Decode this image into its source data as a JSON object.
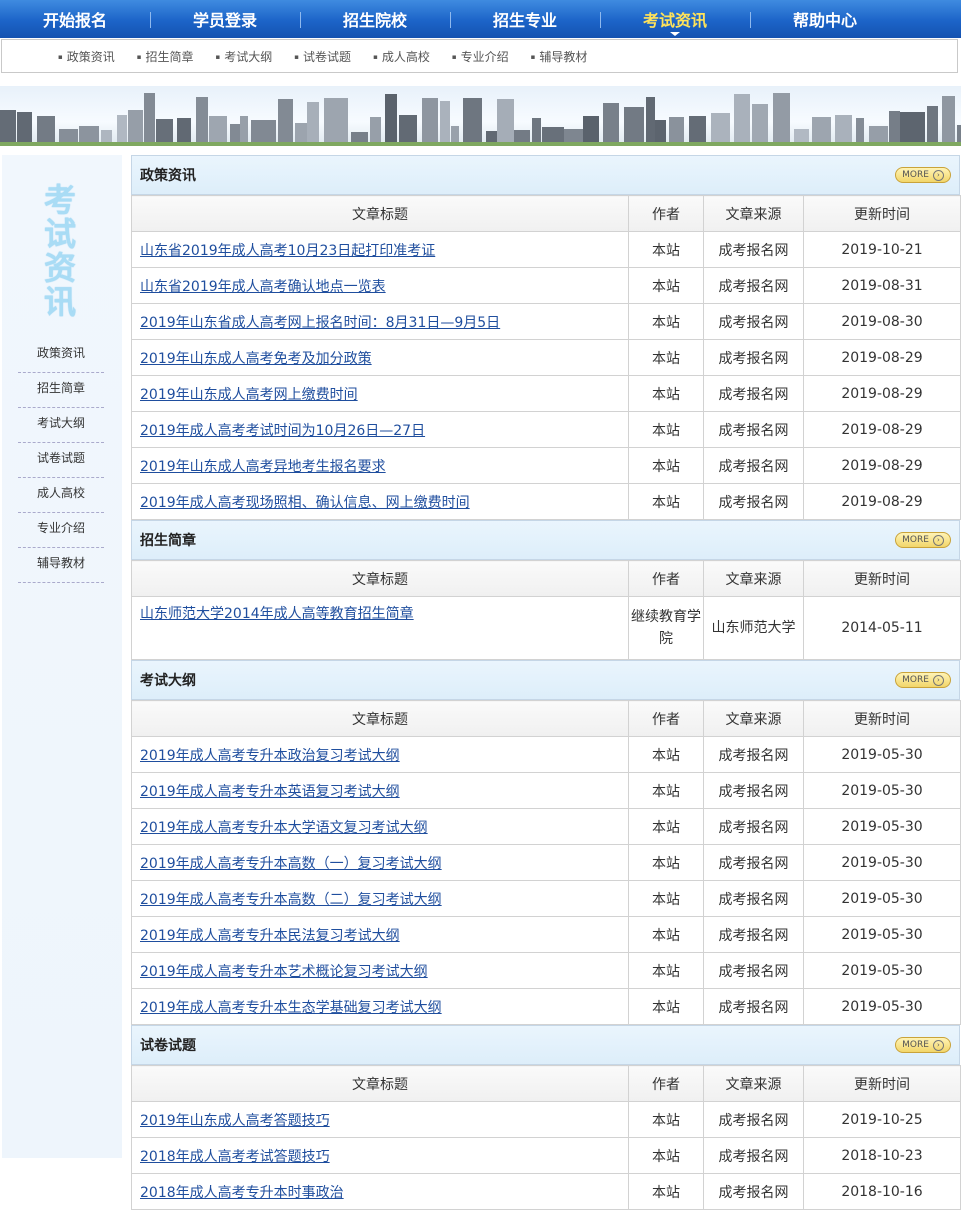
{
  "topnav": [
    {
      "label": "开始报名",
      "active": false
    },
    {
      "label": "学员登录",
      "active": false
    },
    {
      "label": "招生院校",
      "active": false
    },
    {
      "label": "招生专业",
      "active": false
    },
    {
      "label": "考试资讯",
      "active": true
    },
    {
      "label": "帮助中心",
      "active": false
    }
  ],
  "subnav": [
    "政策资讯",
    "招生简章",
    "考试大纲",
    "试卷试题",
    "成人高校",
    "专业介绍",
    "辅导教材"
  ],
  "sidebar": {
    "title": "考试资讯",
    "items": [
      "政策资讯",
      "招生简章",
      "考试大纲",
      "试卷试题",
      "成人高校",
      "专业介绍",
      "辅导教材"
    ]
  },
  "table_headers": {
    "title": "文章标题",
    "author": "作者",
    "source": "文章来源",
    "date": "更新时间"
  },
  "more_label": "MORE",
  "sections": [
    {
      "title": "政策资讯",
      "rows": [
        {
          "title": "山东省2019年成人高考10月23日起打印准考证",
          "author": "本站",
          "source": "成考报名网",
          "date": "2019-10-21"
        },
        {
          "title": "山东省2019年成人高考确认地点一览表",
          "author": "本站",
          "source": "成考报名网",
          "date": "2019-08-31"
        },
        {
          "title": "2019年山东省成人高考网上报名时间：8月31日—9月5日",
          "author": "本站",
          "source": "成考报名网",
          "date": "2019-08-30"
        },
        {
          "title": "2019年山东成人高考免考及加分政策",
          "author": "本站",
          "source": "成考报名网",
          "date": "2019-08-29"
        },
        {
          "title": "2019年山东成人高考网上缴费时间",
          "author": "本站",
          "source": "成考报名网",
          "date": "2019-08-29"
        },
        {
          "title": "2019年成人高考考试时间为10月26日—27日",
          "author": "本站",
          "source": "成考报名网",
          "date": "2019-08-29"
        },
        {
          "title": "2019年山东成人高考异地考生报名要求",
          "author": "本站",
          "source": "成考报名网",
          "date": "2019-08-29"
        },
        {
          "title": "2019年成人高考现场照相、确认信息、网上缴费时间",
          "author": "本站",
          "source": "成考报名网",
          "date": "2019-08-29"
        }
      ]
    },
    {
      "title": "招生简章",
      "rows": [
        {
          "title": "山东师范大学2014年成人高等教育招生简章",
          "author": "继续教育学院",
          "source": "山东师范大学",
          "date": "2014-05-11",
          "tall": true
        }
      ]
    },
    {
      "title": "考试大纲",
      "rows": [
        {
          "title": "2019年成人高考专升本政治复习考试大纲",
          "author": "本站",
          "source": "成考报名网",
          "date": "2019-05-30"
        },
        {
          "title": "2019年成人高考专升本英语复习考试大纲",
          "author": "本站",
          "source": "成考报名网",
          "date": "2019-05-30"
        },
        {
          "title": "2019年成人高考专升本大学语文复习考试大纲",
          "author": "本站",
          "source": "成考报名网",
          "date": "2019-05-30"
        },
        {
          "title": "2019年成人高考专升本高数（一）复习考试大纲",
          "author": "本站",
          "source": "成考报名网",
          "date": "2019-05-30"
        },
        {
          "title": "2019年成人高考专升本高数（二）复习考试大纲",
          "author": "本站",
          "source": "成考报名网",
          "date": "2019-05-30"
        },
        {
          "title": "2019年成人高考专升本民法复习考试大纲",
          "author": "本站",
          "source": "成考报名网",
          "date": "2019-05-30"
        },
        {
          "title": "2019年成人高考专升本艺术概论复习考试大纲",
          "author": "本站",
          "source": "成考报名网",
          "date": "2019-05-30"
        },
        {
          "title": "2019年成人高考专升本生态学基础复习考试大纲",
          "author": "本站",
          "source": "成考报名网",
          "date": "2019-05-30"
        }
      ]
    },
    {
      "title": "试卷试题",
      "rows": [
        {
          "title": "2019年山东成人高考答题技巧",
          "author": "本站",
          "source": "成考报名网",
          "date": "2019-10-25"
        },
        {
          "title": "2018年成人高考考试答题技巧",
          "author": "本站",
          "source": "成考报名网",
          "date": "2018-10-23"
        },
        {
          "title": "2018年成人高考专升本时事政治",
          "author": "本站",
          "source": "成考报名网",
          "date": "2018-10-16"
        }
      ]
    }
  ],
  "colors": {
    "nav_blue": "#1c64c8",
    "active_nav": "#ffe35a",
    "link": "#1f4e9e",
    "sidebar_title": "#a9dcf5"
  }
}
